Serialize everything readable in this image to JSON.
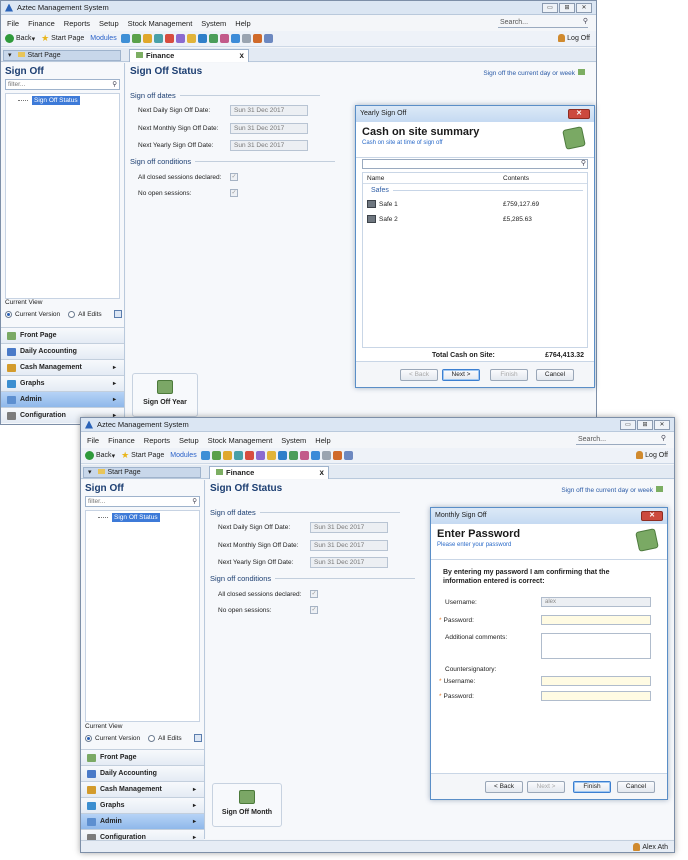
{
  "app_title": "Aztec Management System",
  "window_controls": {
    "minimize": "▭",
    "maximize": "⊞",
    "close": "✕"
  },
  "menu": [
    "File",
    "Finance",
    "Reports",
    "Setup",
    "Stock Management",
    "System",
    "Help"
  ],
  "search_label": "Search...",
  "toolbar": {
    "back": "Back",
    "start_page": "Start Page",
    "modules": "Modules",
    "log_off": "Log Off"
  },
  "tabs": {
    "start": "Start Page",
    "finance": "Finance",
    "close_glyph": "x"
  },
  "sign_off_panel": {
    "title": "Sign Off",
    "filter_placeholder": "filter...",
    "tree_item": "Sign Off Status",
    "current_view_label": "Current View",
    "current_version": "Current Version",
    "all_edits": "All Edits"
  },
  "nav_items": [
    {
      "label": "Front Page",
      "arrow": "",
      "icon_color": "#7aa964"
    },
    {
      "label": "Daily Accounting",
      "arrow": "",
      "icon_color": "#4a7ac8"
    },
    {
      "label": "Cash Management",
      "arrow": "▸",
      "icon_color": "#d39b2c"
    },
    {
      "label": "Graphs",
      "arrow": "▸",
      "icon_color": "#3b8ed0"
    },
    {
      "label": "Admin",
      "arrow": "▸",
      "icon_color": "#8fb8ea"
    },
    {
      "label": "Configuration",
      "arrow": "▸",
      "icon_color": "#7c7c7c"
    }
  ],
  "sign_off_status": {
    "title": "Sign Off Status",
    "right_link": "Sign off the current day or week",
    "dates_header": "Sign off dates",
    "daily_label": "Next Daily Sign Off Date:",
    "monthly_label": "Next Monthly Sign Off Date:",
    "yearly_label": "Next Yearly Sign Off Date:",
    "date_value": "Sun 31 Dec 2017",
    "conditions_header": "Sign off conditions",
    "closed_sessions": "All closed sessions declared:",
    "no_open_sessions": "No open sessions:",
    "check_glyph": "✓"
  },
  "big_buttons": {
    "year": "Sign Off Year",
    "month": "Sign Off Month"
  },
  "yearly_dialog": {
    "window_title": "Yearly Sign Off",
    "heading": "Cash on site summary",
    "subheading": "Cash on site at time of sign off",
    "col_name": "Name",
    "col_contents": "Contents",
    "group": "Safes",
    "rows": [
      {
        "name": "Safe 1",
        "amount": "£759,127.69"
      },
      {
        "name": "Safe 2",
        "amount": "£5,285.63"
      }
    ],
    "total_label": "Total Cash on Site:",
    "total_value": "£764,413.32",
    "buttons": {
      "back": "< Back",
      "next": "Next >",
      "finish": "Finish",
      "cancel": "Cancel"
    }
  },
  "monthly_dialog": {
    "window_title": "Monthly Sign Off",
    "heading": "Enter Password",
    "subheading": "Please enter your password",
    "confirm_text": "By entering my password I am confirming that the information entered is correct:",
    "username_label": "Username:",
    "username_value": "alex",
    "password_label": "Password:",
    "comments_label": "Additional comments:",
    "countersignatory": "Countersignatory:",
    "cs_username_label": "Username:",
    "cs_password_label": "Password:",
    "required_mark": "*",
    "buttons": {
      "back": "< Back",
      "next": "Next >",
      "finish": "Finish",
      "cancel": "Cancel"
    }
  },
  "status_user": "Alex Ath",
  "toolbar_icon_colors": [
    "#3e8fd6",
    "#5aa14a",
    "#e0a82c",
    "#48a0a8",
    "#d74c3f",
    "#8b6bd0",
    "#e1b43a",
    "#2f7fc9",
    "#4a9d5a",
    "#c25a8a",
    "#3c8bd8",
    "#9aa4b0",
    "#d06a2a",
    "#6c88c0"
  ]
}
